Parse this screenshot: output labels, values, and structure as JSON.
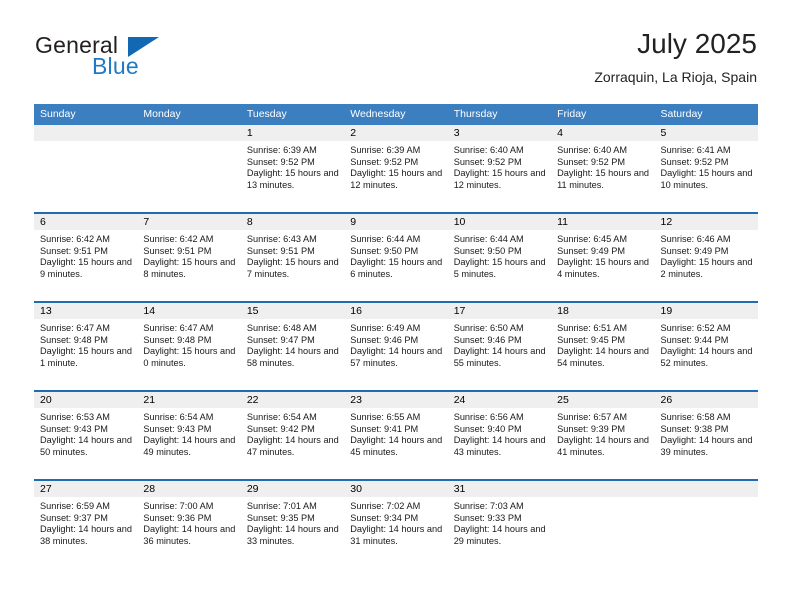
{
  "brand": {
    "name_part1": "General",
    "name_part2": "Blue",
    "logo_icon": "blue-triangle-flag"
  },
  "header": {
    "title": "July 2025",
    "subtitle": "Zorraquin, La Rioja, Spain"
  },
  "colors": {
    "header_blue": "#3c7fc1",
    "row_divider_blue": "#1f6cb0",
    "day_band_gray": "#efefef",
    "brand_blue": "#1268b3",
    "text": "#1a1a1a"
  },
  "labels": {
    "sunrise_prefix": "Sunrise:",
    "sunset_prefix": "Sunset:",
    "daylight_prefix": "Daylight:"
  },
  "weekdays": [
    "Sunday",
    "Monday",
    "Tuesday",
    "Wednesday",
    "Thursday",
    "Friday",
    "Saturday"
  ],
  "weeks": [
    [
      {
        "day": "",
        "empty": true
      },
      {
        "day": "",
        "empty": true
      },
      {
        "day": "1",
        "sunrise": "Sunrise: 6:39 AM",
        "sunset": "Sunset: 9:52 PM",
        "daylight": "Daylight: 15 hours and 13 minutes."
      },
      {
        "day": "2",
        "sunrise": "Sunrise: 6:39 AM",
        "sunset": "Sunset: 9:52 PM",
        "daylight": "Daylight: 15 hours and 12 minutes."
      },
      {
        "day": "3",
        "sunrise": "Sunrise: 6:40 AM",
        "sunset": "Sunset: 9:52 PM",
        "daylight": "Daylight: 15 hours and 12 minutes."
      },
      {
        "day": "4",
        "sunrise": "Sunrise: 6:40 AM",
        "sunset": "Sunset: 9:52 PM",
        "daylight": "Daylight: 15 hours and 11 minutes."
      },
      {
        "day": "5",
        "sunrise": "Sunrise: 6:41 AM",
        "sunset": "Sunset: 9:52 PM",
        "daylight": "Daylight: 15 hours and 10 minutes."
      }
    ],
    [
      {
        "day": "6",
        "sunrise": "Sunrise: 6:42 AM",
        "sunset": "Sunset: 9:51 PM",
        "daylight": "Daylight: 15 hours and 9 minutes."
      },
      {
        "day": "7",
        "sunrise": "Sunrise: 6:42 AM",
        "sunset": "Sunset: 9:51 PM",
        "daylight": "Daylight: 15 hours and 8 minutes."
      },
      {
        "day": "8",
        "sunrise": "Sunrise: 6:43 AM",
        "sunset": "Sunset: 9:51 PM",
        "daylight": "Daylight: 15 hours and 7 minutes."
      },
      {
        "day": "9",
        "sunrise": "Sunrise: 6:44 AM",
        "sunset": "Sunset: 9:50 PM",
        "daylight": "Daylight: 15 hours and 6 minutes."
      },
      {
        "day": "10",
        "sunrise": "Sunrise: 6:44 AM",
        "sunset": "Sunset: 9:50 PM",
        "daylight": "Daylight: 15 hours and 5 minutes."
      },
      {
        "day": "11",
        "sunrise": "Sunrise: 6:45 AM",
        "sunset": "Sunset: 9:49 PM",
        "daylight": "Daylight: 15 hours and 4 minutes."
      },
      {
        "day": "12",
        "sunrise": "Sunrise: 6:46 AM",
        "sunset": "Sunset: 9:49 PM",
        "daylight": "Daylight: 15 hours and 2 minutes."
      }
    ],
    [
      {
        "day": "13",
        "sunrise": "Sunrise: 6:47 AM",
        "sunset": "Sunset: 9:48 PM",
        "daylight": "Daylight: 15 hours and 1 minute."
      },
      {
        "day": "14",
        "sunrise": "Sunrise: 6:47 AM",
        "sunset": "Sunset: 9:48 PM",
        "daylight": "Daylight: 15 hours and 0 minutes."
      },
      {
        "day": "15",
        "sunrise": "Sunrise: 6:48 AM",
        "sunset": "Sunset: 9:47 PM",
        "daylight": "Daylight: 14 hours and 58 minutes."
      },
      {
        "day": "16",
        "sunrise": "Sunrise: 6:49 AM",
        "sunset": "Sunset: 9:46 PM",
        "daylight": "Daylight: 14 hours and 57 minutes."
      },
      {
        "day": "17",
        "sunrise": "Sunrise: 6:50 AM",
        "sunset": "Sunset: 9:46 PM",
        "daylight": "Daylight: 14 hours and 55 minutes."
      },
      {
        "day": "18",
        "sunrise": "Sunrise: 6:51 AM",
        "sunset": "Sunset: 9:45 PM",
        "daylight": "Daylight: 14 hours and 54 minutes."
      },
      {
        "day": "19",
        "sunrise": "Sunrise: 6:52 AM",
        "sunset": "Sunset: 9:44 PM",
        "daylight": "Daylight: 14 hours and 52 minutes."
      }
    ],
    [
      {
        "day": "20",
        "sunrise": "Sunrise: 6:53 AM",
        "sunset": "Sunset: 9:43 PM",
        "daylight": "Daylight: 14 hours and 50 minutes."
      },
      {
        "day": "21",
        "sunrise": "Sunrise: 6:54 AM",
        "sunset": "Sunset: 9:43 PM",
        "daylight": "Daylight: 14 hours and 49 minutes."
      },
      {
        "day": "22",
        "sunrise": "Sunrise: 6:54 AM",
        "sunset": "Sunset: 9:42 PM",
        "daylight": "Daylight: 14 hours and 47 minutes."
      },
      {
        "day": "23",
        "sunrise": "Sunrise: 6:55 AM",
        "sunset": "Sunset: 9:41 PM",
        "daylight": "Daylight: 14 hours and 45 minutes."
      },
      {
        "day": "24",
        "sunrise": "Sunrise: 6:56 AM",
        "sunset": "Sunset: 9:40 PM",
        "daylight": "Daylight: 14 hours and 43 minutes."
      },
      {
        "day": "25",
        "sunrise": "Sunrise: 6:57 AM",
        "sunset": "Sunset: 9:39 PM",
        "daylight": "Daylight: 14 hours and 41 minutes."
      },
      {
        "day": "26",
        "sunrise": "Sunrise: 6:58 AM",
        "sunset": "Sunset: 9:38 PM",
        "daylight": "Daylight: 14 hours and 39 minutes."
      }
    ],
    [
      {
        "day": "27",
        "sunrise": "Sunrise: 6:59 AM",
        "sunset": "Sunset: 9:37 PM",
        "daylight": "Daylight: 14 hours and 38 minutes."
      },
      {
        "day": "28",
        "sunrise": "Sunrise: 7:00 AM",
        "sunset": "Sunset: 9:36 PM",
        "daylight": "Daylight: 14 hours and 36 minutes."
      },
      {
        "day": "29",
        "sunrise": "Sunrise: 7:01 AM",
        "sunset": "Sunset: 9:35 PM",
        "daylight": "Daylight: 14 hours and 33 minutes."
      },
      {
        "day": "30",
        "sunrise": "Sunrise: 7:02 AM",
        "sunset": "Sunset: 9:34 PM",
        "daylight": "Daylight: 14 hours and 31 minutes."
      },
      {
        "day": "31",
        "sunrise": "Sunrise: 7:03 AM",
        "sunset": "Sunset: 9:33 PM",
        "daylight": "Daylight: 14 hours and 29 minutes."
      },
      {
        "day": "",
        "empty": true
      },
      {
        "day": "",
        "empty": true
      }
    ]
  ]
}
